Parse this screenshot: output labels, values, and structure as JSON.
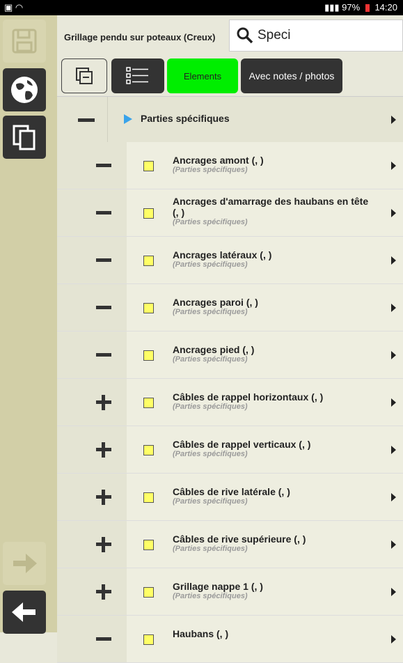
{
  "status_bar": {
    "battery": "97%",
    "time": "14:20"
  },
  "header": {
    "title": "Grillage pendu sur poteaux (Creux)",
    "search_value": "Speci"
  },
  "toolbar": {
    "elements_label": "Elements",
    "notes_label": "Avec notes / photos"
  },
  "group": {
    "label": "Parties spécifiques"
  },
  "items": [
    {
      "name": "Ancrages amont (, )",
      "sub": "(Parties spécifiques)",
      "toggle": "minus"
    },
    {
      "name": "Ancrages d'amarrage des haubans en tête (, )",
      "sub": "(Parties spécifiques)",
      "toggle": "minus"
    },
    {
      "name": "Ancrages latéraux (, )",
      "sub": "(Parties spécifiques)",
      "toggle": "minus"
    },
    {
      "name": "Ancrages paroi (, )",
      "sub": "(Parties spécifiques)",
      "toggle": "minus"
    },
    {
      "name": "Ancrages pied (, )",
      "sub": "(Parties spécifiques)",
      "toggle": "minus"
    },
    {
      "name": "Câbles de rappel horizontaux (, )",
      "sub": "(Parties spécifiques)",
      "toggle": "plus"
    },
    {
      "name": "Câbles de rappel verticaux (, )",
      "sub": "(Parties spécifiques)",
      "toggle": "plus"
    },
    {
      "name": "Câbles de rive latérale (, )",
      "sub": "(Parties spécifiques)",
      "toggle": "plus"
    },
    {
      "name": "Câbles de rive supérieure (, )",
      "sub": "(Parties spécifiques)",
      "toggle": "plus"
    },
    {
      "name": "Grillage nappe 1 (, )",
      "sub": "(Parties spécifiques)",
      "toggle": "plus"
    },
    {
      "name": "Haubans (, )",
      "sub": "",
      "toggle": "minus"
    }
  ],
  "colors": {
    "sidebar": "#d2cfa7",
    "elements_button": "#00ee00",
    "item_square": "#ffff66",
    "expand_arrow": "#39a3ea"
  }
}
